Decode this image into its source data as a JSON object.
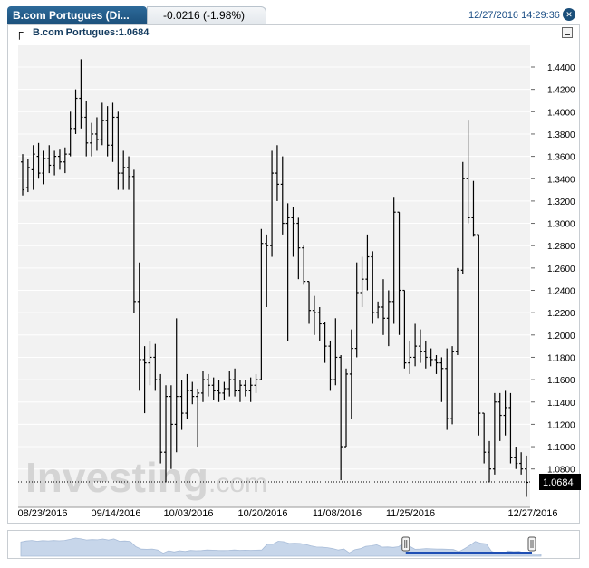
{
  "header": {
    "instrument_tab": "B.com Portugues (Di...",
    "change": "-0.0216 (-1.98%)",
    "datetime": "12/27/2016 14:29:36",
    "close_icon": "close-icon"
  },
  "legend": {
    "label": "B.com Portugues:1.0684",
    "icon": "ohlc-bar-icon"
  },
  "watermark": {
    "brand": "Investing",
    "suffix": ".com"
  },
  "colors": {
    "bars": "#000000",
    "panel_bg": "#f2f2f2",
    "price_box": "#000000",
    "navigator_fill": "#c7d6ea",
    "navigator_window": "#1f4fb4"
  },
  "chart_data": {
    "type": "ohlc",
    "ylim": [
      1.06,
      1.46
    ],
    "y_ticks": [
      "1.4400",
      "1.4200",
      "1.4000",
      "1.3800",
      "1.3600",
      "1.3400",
      "1.3200",
      "1.3000",
      "1.2800",
      "1.2600",
      "1.2400",
      "1.2200",
      "1.2000",
      "1.1800",
      "1.1600",
      "1.1400",
      "1.1200",
      "1.1000",
      "1.0800"
    ],
    "x_ticks": [
      "08/23/2016",
      "09/14/2016",
      "10/03/2016",
      "10/20/2016",
      "11/08/2016",
      "11/25/2016",
      "12/27/2016"
    ],
    "last_price": "1.0684",
    "last_value": 1.0684,
    "grid": true,
    "series": [
      {
        "date": "08/23/2016",
        "open": 1.355,
        "high": 1.362,
        "low": 1.325,
        "close": 1.33
      },
      {
        "date": "08/24/2016",
        "open": 1.332,
        "high": 1.358,
        "low": 1.328,
        "close": 1.35
      },
      {
        "date": "08/25/2016",
        "open": 1.348,
        "high": 1.37,
        "low": 1.33,
        "close": 1.362
      },
      {
        "date": "08/26/2016",
        "open": 1.36,
        "high": 1.372,
        "low": 1.34,
        "close": 1.345
      },
      {
        "date": "08/29/2016",
        "open": 1.345,
        "high": 1.365,
        "low": 1.335,
        "close": 1.358
      },
      {
        "date": "08/30/2016",
        "open": 1.358,
        "high": 1.37,
        "low": 1.345,
        "close": 1.352
      },
      {
        "date": "08/31/2016",
        "open": 1.352,
        "high": 1.365,
        "low": 1.343,
        "close": 1.36
      },
      {
        "date": "09/01/2016",
        "open": 1.36,
        "high": 1.366,
        "low": 1.348,
        "close": 1.355
      },
      {
        "date": "09/02/2016",
        "open": 1.355,
        "high": 1.368,
        "low": 1.345,
        "close": 1.362
      },
      {
        "date": "09/05/2016",
        "open": 1.362,
        "high": 1.4,
        "low": 1.36,
        "close": 1.385
      },
      {
        "date": "09/06/2016",
        "open": 1.385,
        "high": 1.42,
        "low": 1.38,
        "close": 1.412
      },
      {
        "date": "09/07/2016",
        "open": 1.412,
        "high": 1.447,
        "low": 1.385,
        "close": 1.395
      },
      {
        "date": "09/08/2016",
        "open": 1.395,
        "high": 1.41,
        "low": 1.36,
        "close": 1.372
      },
      {
        "date": "09/09/2016",
        "open": 1.372,
        "high": 1.39,
        "low": 1.36,
        "close": 1.38
      },
      {
        "date": "09/12/2016",
        "open": 1.38,
        "high": 1.395,
        "low": 1.365,
        "close": 1.375
      },
      {
        "date": "09/13/2016",
        "open": 1.375,
        "high": 1.408,
        "low": 1.37,
        "close": 1.392
      },
      {
        "date": "09/14/2016",
        "open": 1.392,
        "high": 1.405,
        "low": 1.36,
        "close": 1.37
      },
      {
        "date": "09/15/2016",
        "open": 1.37,
        "high": 1.408,
        "low": 1.355,
        "close": 1.395
      },
      {
        "date": "09/16/2016",
        "open": 1.395,
        "high": 1.4,
        "low": 1.33,
        "close": 1.345
      },
      {
        "date": "09/19/2016",
        "open": 1.345,
        "high": 1.365,
        "low": 1.33,
        "close": 1.35
      },
      {
        "date": "09/20/2016",
        "open": 1.35,
        "high": 1.36,
        "low": 1.33,
        "close": 1.342
      },
      {
        "date": "09/21/2016",
        "open": 1.342,
        "high": 1.348,
        "low": 1.22,
        "close": 1.23
      },
      {
        "date": "09/22/2016",
        "open": 1.23,
        "high": 1.265,
        "low": 1.15,
        "close": 1.178
      },
      {
        "date": "09/23/2016",
        "open": 1.178,
        "high": 1.19,
        "low": 1.13,
        "close": 1.175
      },
      {
        "date": "09/26/2016",
        "open": 1.175,
        "high": 1.195,
        "low": 1.155,
        "close": 1.18
      },
      {
        "date": "09/27/2016",
        "open": 1.18,
        "high": 1.192,
        "low": 1.15,
        "close": 1.16
      },
      {
        "date": "09/28/2016",
        "open": 1.16,
        "high": 1.165,
        "low": 1.085,
        "close": 1.095
      },
      {
        "date": "09/29/2016",
        "open": 1.095,
        "high": 1.155,
        "low": 1.068,
        "close": 1.145
      },
      {
        "date": "09/30/2016",
        "open": 1.145,
        "high": 1.155,
        "low": 1.08,
        "close": 1.12
      },
      {
        "date": "10/03/2016",
        "open": 1.12,
        "high": 1.215,
        "low": 1.095,
        "close": 1.145
      },
      {
        "date": "10/04/2016",
        "open": 1.145,
        "high": 1.16,
        "low": 1.115,
        "close": 1.13
      },
      {
        "date": "10/05/2016",
        "open": 1.13,
        "high": 1.165,
        "low": 1.125,
        "close": 1.15
      },
      {
        "date": "10/06/2016",
        "open": 1.15,
        "high": 1.158,
        "low": 1.138,
        "close": 1.145
      },
      {
        "date": "10/07/2016",
        "open": 1.145,
        "high": 1.152,
        "low": 1.1,
        "close": 1.148
      },
      {
        "date": "10/10/2016",
        "open": 1.148,
        "high": 1.168,
        "low": 1.14,
        "close": 1.16
      },
      {
        "date": "10/11/2016",
        "open": 1.16,
        "high": 1.165,
        "low": 1.145,
        "close": 1.155
      },
      {
        "date": "10/12/2016",
        "open": 1.155,
        "high": 1.162,
        "low": 1.142,
        "close": 1.15
      },
      {
        "date": "10/13/2016",
        "open": 1.15,
        "high": 1.16,
        "low": 1.14,
        "close": 1.148
      },
      {
        "date": "10/14/2016",
        "open": 1.148,
        "high": 1.158,
        "low": 1.142,
        "close": 1.152
      },
      {
        "date": "10/17/2016",
        "open": 1.152,
        "high": 1.168,
        "low": 1.145,
        "close": 1.16
      },
      {
        "date": "10/18/2016",
        "open": 1.16,
        "high": 1.17,
        "low": 1.145,
        "close": 1.15
      },
      {
        "date": "10/19/2016",
        "open": 1.15,
        "high": 1.16,
        "low": 1.14,
        "close": 1.155
      },
      {
        "date": "10/20/2016",
        "open": 1.155,
        "high": 1.16,
        "low": 1.145,
        "close": 1.15
      },
      {
        "date": "10/21/2016",
        "open": 1.15,
        "high": 1.162,
        "low": 1.14,
        "close": 1.155
      },
      {
        "date": "10/24/2016",
        "open": 1.155,
        "high": 1.165,
        "low": 1.148,
        "close": 1.16
      },
      {
        "date": "10/25/2016",
        "open": 1.16,
        "high": 1.295,
        "low": 1.17,
        "close": 1.282
      },
      {
        "date": "10/26/2016",
        "open": 1.282,
        "high": 1.29,
        "low": 1.225,
        "close": 1.28
      },
      {
        "date": "10/27/2016",
        "open": 1.28,
        "high": 1.365,
        "low": 1.27,
        "close": 1.345
      },
      {
        "date": "10/28/2016",
        "open": 1.345,
        "high": 1.37,
        "low": 1.32,
        "close": 1.335
      },
      {
        "date": "10/31/2016",
        "open": 1.335,
        "high": 1.36,
        "low": 1.29,
        "close": 1.3
      },
      {
        "date": "11/01/2016",
        "open": 1.3,
        "high": 1.318,
        "low": 1.195,
        "close": 1.305
      },
      {
        "date": "11/02/2016",
        "open": 1.305,
        "high": 1.315,
        "low": 1.27,
        "close": 1.3
      },
      {
        "date": "11/03/2016",
        "open": 1.3,
        "high": 1.305,
        "low": 1.25,
        "close": 1.278
      },
      {
        "date": "11/04/2016",
        "open": 1.278,
        "high": 1.28,
        "low": 1.245,
        "close": 1.248
      },
      {
        "date": "11/07/2016",
        "open": 1.248,
        "high": 1.245,
        "low": 1.21,
        "close": 1.222
      },
      {
        "date": "11/08/2016",
        "open": 1.222,
        "high": 1.235,
        "low": 1.2,
        "close": 1.22
      },
      {
        "date": "11/09/2016",
        "open": 1.22,
        "high": 1.225,
        "low": 1.195,
        "close": 1.21
      },
      {
        "date": "11/10/2016",
        "open": 1.21,
        "high": 1.212,
        "low": 1.175,
        "close": 1.19
      },
      {
        "date": "11/11/2016",
        "open": 1.19,
        "high": 1.195,
        "low": 1.15,
        "close": 1.16
      },
      {
        "date": "11/14/2016",
        "open": 1.16,
        "high": 1.215,
        "low": 1.155,
        "close": 1.18
      },
      {
        "date": "11/15/2016",
        "open": 1.18,
        "high": 1.182,
        "low": 1.07,
        "close": 1.1
      },
      {
        "date": "11/16/2016",
        "open": 1.1,
        "high": 1.17,
        "low": 1.12,
        "close": 1.165
      },
      {
        "date": "11/17/2016",
        "open": 1.165,
        "high": 1.205,
        "low": 1.125,
        "close": 1.188
      },
      {
        "date": "11/18/2016",
        "open": 1.188,
        "high": 1.265,
        "low": 1.18,
        "close": 1.238
      },
      {
        "date": "11/21/2016",
        "open": 1.238,
        "high": 1.27,
        "low": 1.225,
        "close": 1.25
      },
      {
        "date": "11/22/2016",
        "open": 1.25,
        "high": 1.29,
        "low": 1.24,
        "close": 1.27
      },
      {
        "date": "11/23/2016",
        "open": 1.27,
        "high": 1.275,
        "low": 1.21,
        "close": 1.22
      },
      {
        "date": "11/24/2016",
        "open": 1.22,
        "high": 1.23,
        "low": 1.215,
        "close": 1.225
      },
      {
        "date": "11/25/2016",
        "open": 1.225,
        "high": 1.25,
        "low": 1.2,
        "close": 1.215
      },
      {
        "date": "11/28/2016",
        "open": 1.215,
        "high": 1.24,
        "low": 1.19,
        "close": 1.23
      },
      {
        "date": "11/29/2016",
        "open": 1.23,
        "high": 1.323,
        "low": 1.21,
        "close": 1.31
      },
      {
        "date": "11/30/2016",
        "open": 1.31,
        "high": 1.245,
        "low": 1.2,
        "close": 1.24
      },
      {
        "date": "12/01/2016",
        "open": 1.24,
        "high": 1.225,
        "low": 1.17,
        "close": 1.175
      },
      {
        "date": "12/02/2016",
        "open": 1.175,
        "high": 1.195,
        "low": 1.165,
        "close": 1.18
      },
      {
        "date": "12/05/2016",
        "open": 1.18,
        "high": 1.21,
        "low": 1.172,
        "close": 1.19
      },
      {
        "date": "12/06/2016",
        "open": 1.19,
        "high": 1.205,
        "low": 1.175,
        "close": 1.185
      },
      {
        "date": "12/07/2016",
        "open": 1.185,
        "high": 1.195,
        "low": 1.17,
        "close": 1.18
      },
      {
        "date": "12/08/2016",
        "open": 1.18,
        "high": 1.188,
        "low": 1.172,
        "close": 1.178
      },
      {
        "date": "12/09/2016",
        "open": 1.178,
        "high": 1.182,
        "low": 1.165,
        "close": 1.175
      },
      {
        "date": "12/12/2016",
        "open": 1.175,
        "high": 1.18,
        "low": 1.14,
        "close": 1.17
      },
      {
        "date": "12/13/2016",
        "open": 1.17,
        "high": 1.188,
        "low": 1.115,
        "close": 1.125
      },
      {
        "date": "12/14/2016",
        "open": 1.125,
        "high": 1.19,
        "low": 1.12,
        "close": 1.185
      },
      {
        "date": "12/15/2016",
        "open": 1.185,
        "high": 1.26,
        "low": 1.182,
        "close": 1.258
      },
      {
        "date": "12/16/2016",
        "open": 1.258,
        "high": 1.355,
        "low": 1.255,
        "close": 1.34
      },
      {
        "date": "12/19/2016",
        "open": 1.34,
        "high": 1.392,
        "low": 1.3,
        "close": 1.305
      },
      {
        "date": "12/20/2016",
        "open": 1.305,
        "high": 1.338,
        "low": 1.288,
        "close": 1.29
      },
      {
        "date": "12/21/2016",
        "open": 1.29,
        "high": 1.168,
        "low": 1.11,
        "close": 1.13
      },
      {
        "date": "12/22/2016",
        "open": 1.13,
        "high": 1.128,
        "low": 1.085,
        "close": 1.095
      },
      {
        "date": "12/23/2016",
        "open": 1.095,
        "high": 1.105,
        "low": 1.068,
        "close": 1.08
      },
      {
        "date": "12/26/2016",
        "open": 1.08,
        "high": 1.148,
        "low": 1.075,
        "close": 1.14
      },
      {
        "date": "12/27/2016",
        "open": 1.14,
        "high": 1.148,
        "low": 1.105,
        "close": 1.128
      },
      {
        "date": "12/28/2016",
        "open": 1.128,
        "high": 1.15,
        "low": 1.11,
        "close": 1.135
      },
      {
        "date": "12/29/2016",
        "open": 1.135,
        "high": 1.148,
        "low": 1.085,
        "close": 1.09
      },
      {
        "date": "12/30/2016",
        "open": 1.09,
        "high": 1.1,
        "low": 1.08,
        "close": 1.085
      },
      {
        "date": "01/02/2017",
        "open": 1.085,
        "high": 1.095,
        "low": 1.075,
        "close": 1.08
      },
      {
        "date": "01/03/2017",
        "open": 1.08,
        "high": 1.092,
        "low": 1.055,
        "close": 1.068
      }
    ]
  },
  "navigator": {
    "handle_icon": "drag-handle-icon",
    "window_start": 0.74,
    "window_end": 1.0
  }
}
